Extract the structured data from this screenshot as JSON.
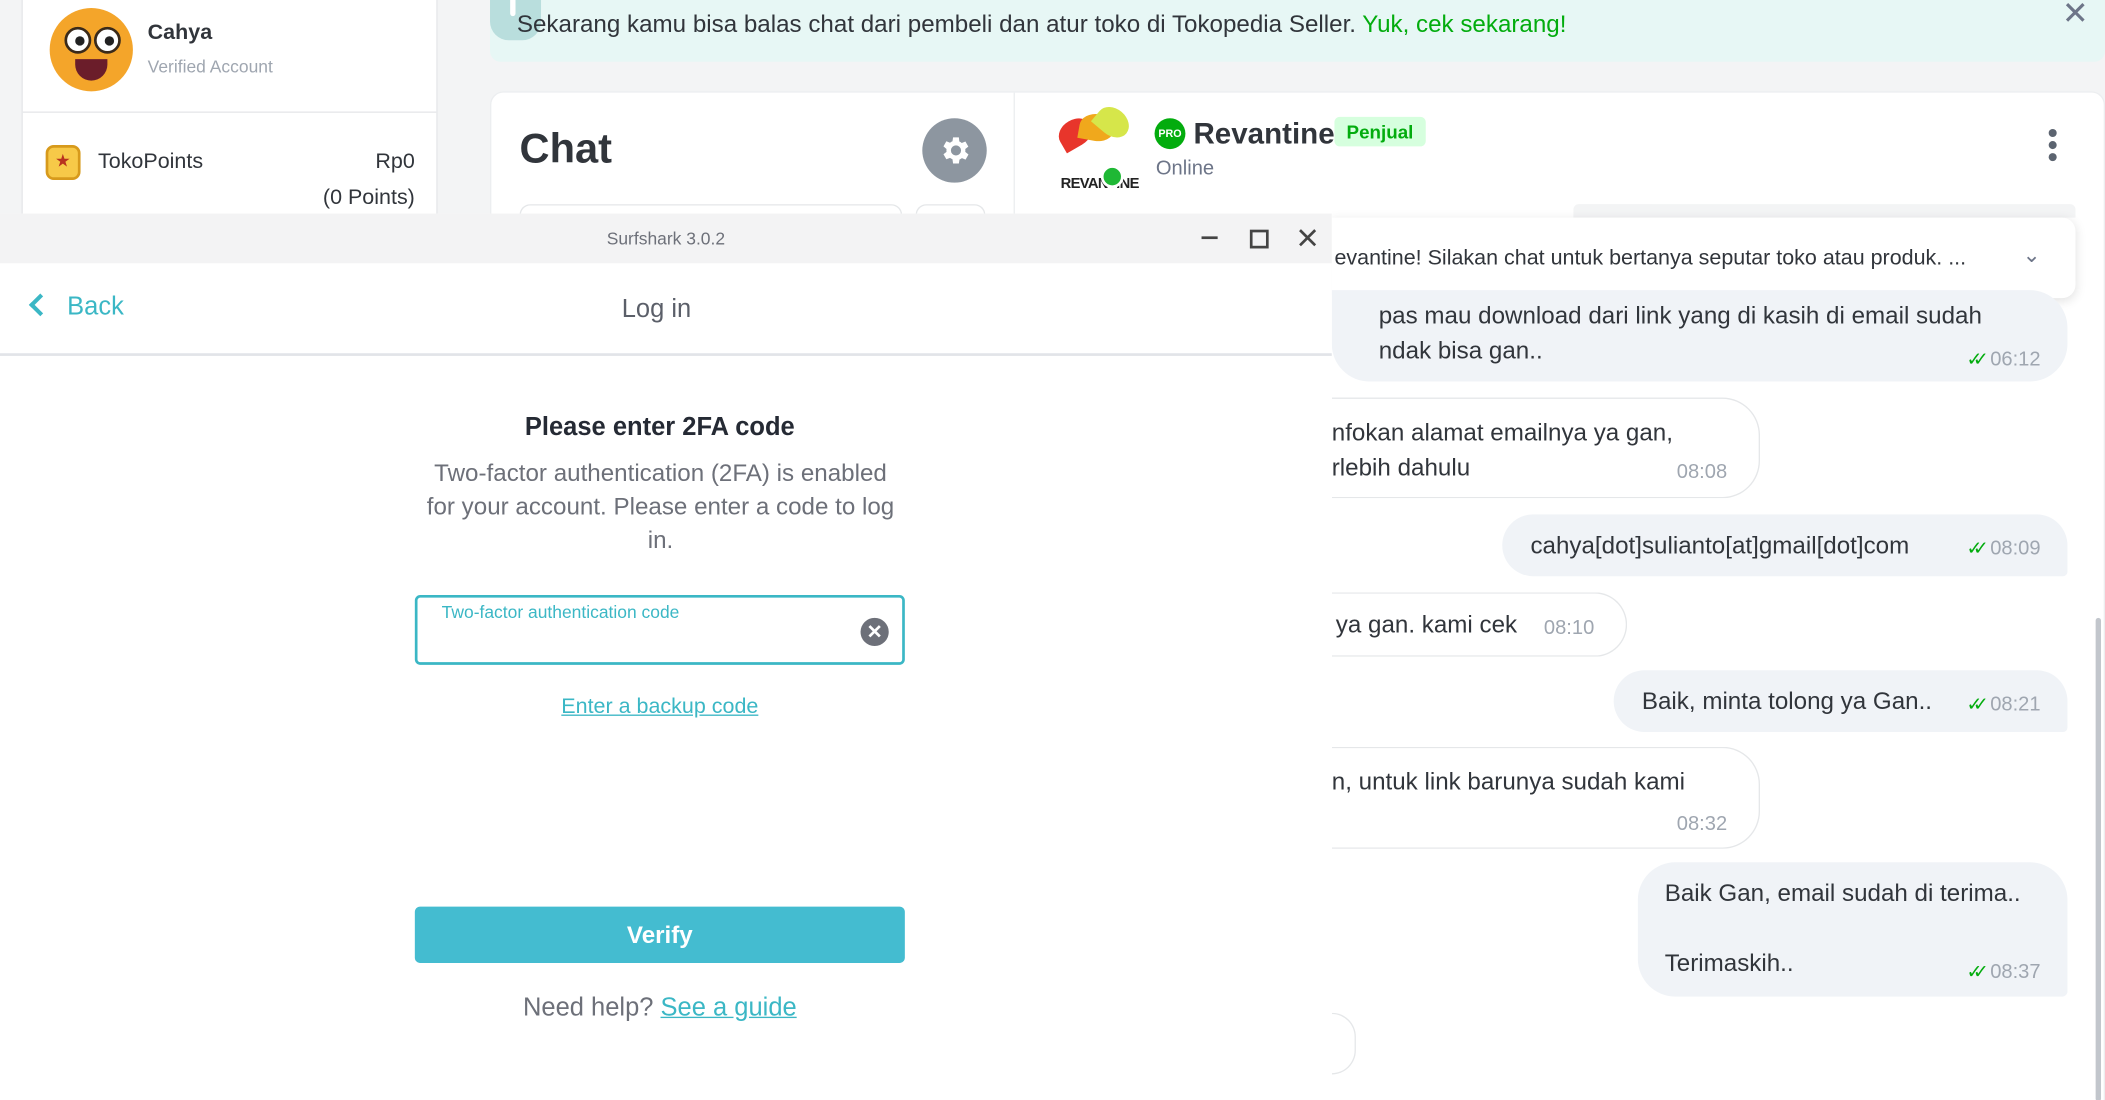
{
  "profile": {
    "name": "Cahya",
    "subtitle": "Verified Account"
  },
  "points": {
    "label": "TokoPoints",
    "value": "Rp0",
    "count": "(0 Points)"
  },
  "banner": {
    "text": "Sekarang kamu bisa balas chat dari pembeli dan atur toko di Tokopedia Seller. ",
    "link": "Yuk, cek sekarang!"
  },
  "chat": {
    "title": "Chat"
  },
  "shop": {
    "logo_text": "REVANTINE",
    "pro_label": "PRO",
    "name": "Revantine",
    "badge": "Penjual",
    "status": "Online"
  },
  "pinned": {
    "text": "evantine! Silakan chat untuk bertanya seputar toko atau produk. ..."
  },
  "messages": [
    {
      "text": "pas mau download dari link yang di kasih di email sudah\nndak bisa gan..",
      "time": "06:12",
      "read": "✓✓"
    },
    {
      "text": "nfokan alamat emailnya ya gan,\nrlebih dahulu",
      "time": "08:08"
    },
    {
      "text": "cahya[dot]sulianto[at]gmail[dot]com",
      "time": "08:09",
      "read": "✓✓"
    },
    {
      "text": "ya gan. kami cek",
      "time": "08:10"
    },
    {
      "text": "Baik, minta tolong ya Gan..",
      "time": "08:21",
      "read": "✓✓"
    },
    {
      "text": "n, untuk link barunya sudah kami",
      "time": "08:32"
    },
    {
      "text": "Baik Gan, email sudah di terima..\n\nTerimaskih..",
      "time": "08:37",
      "read": "✓✓"
    }
  ],
  "surfshark": {
    "window_title": "Surfshark 3.0.2",
    "back_label": "Back",
    "nav_title": "Log in",
    "heading": "Please enter 2FA code",
    "description": "Two-factor authentication (2FA) is enabled for your account. Please enter a code to log in.",
    "code_label": "Two-factor authentication code",
    "code_value": "",
    "backup_link": "Enter a backup code",
    "verify_label": "Verify",
    "help_text": "Need help? ",
    "help_link": "See a guide"
  },
  "colors": {
    "surfshark_accent": "#3bb7c5",
    "verify_button": "#44bcd0",
    "tokopedia_green": "#03ac0e"
  },
  "icons": [
    "gear-icon",
    "chevron-left-icon",
    "clear-icon",
    "chevron-down-icon",
    "kebab-icon",
    "tokopoints-icon",
    "read-receipt-icon"
  ]
}
